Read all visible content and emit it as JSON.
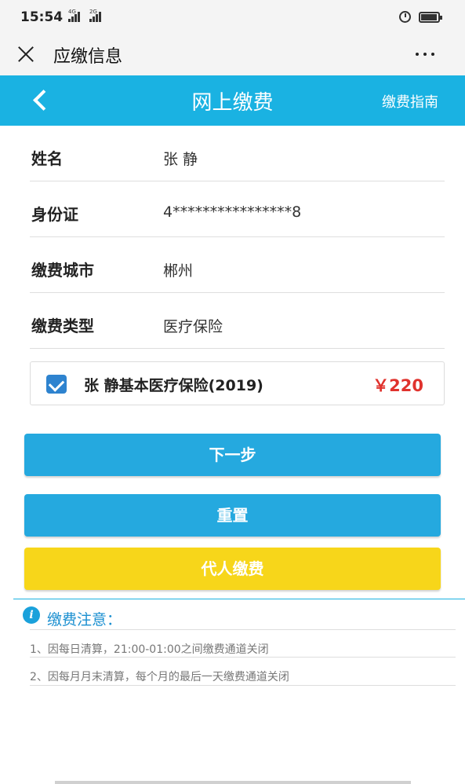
{
  "status_bar": {
    "time": "15:54",
    "signal1_tag": "4G",
    "signal2_tag": "2G",
    "icons": [
      "signal-icon",
      "alarm-icon",
      "battery-icon"
    ]
  },
  "wechat_header": {
    "title": "应缴信息",
    "close_icon": "close-icon",
    "more_icon": "more-icon"
  },
  "navbar": {
    "title": "网上缴费",
    "guide_link": "缴费指南",
    "back_icon": "chevron-left-icon",
    "color": "#1ab2e2"
  },
  "form": {
    "fields": [
      {
        "label": "姓名",
        "value": "张   静"
      },
      {
        "label": "身份证",
        "value": "4****************8"
      },
      {
        "label": "缴费城市",
        "value": "郴州"
      },
      {
        "label": "缴费类型",
        "value": "医疗保险"
      }
    ]
  },
  "item": {
    "checked": true,
    "name": "张   静基本医疗保险(2019)",
    "price": "￥220",
    "price_color": "#e0322d"
  },
  "buttons": {
    "next": "下一步",
    "reset": "重置",
    "proxy_pay": "代人缴费",
    "blue_color": "#25a9df",
    "yellow_color": "#f7d61a"
  },
  "notice": {
    "icon": "info-icon",
    "title": "缴费注意：",
    "items": [
      "1、因每日清算，21:00-01:00之间缴费通道关闭",
      "2、因每月月末清算，每个月的最后一天缴费通道关闭"
    ]
  }
}
